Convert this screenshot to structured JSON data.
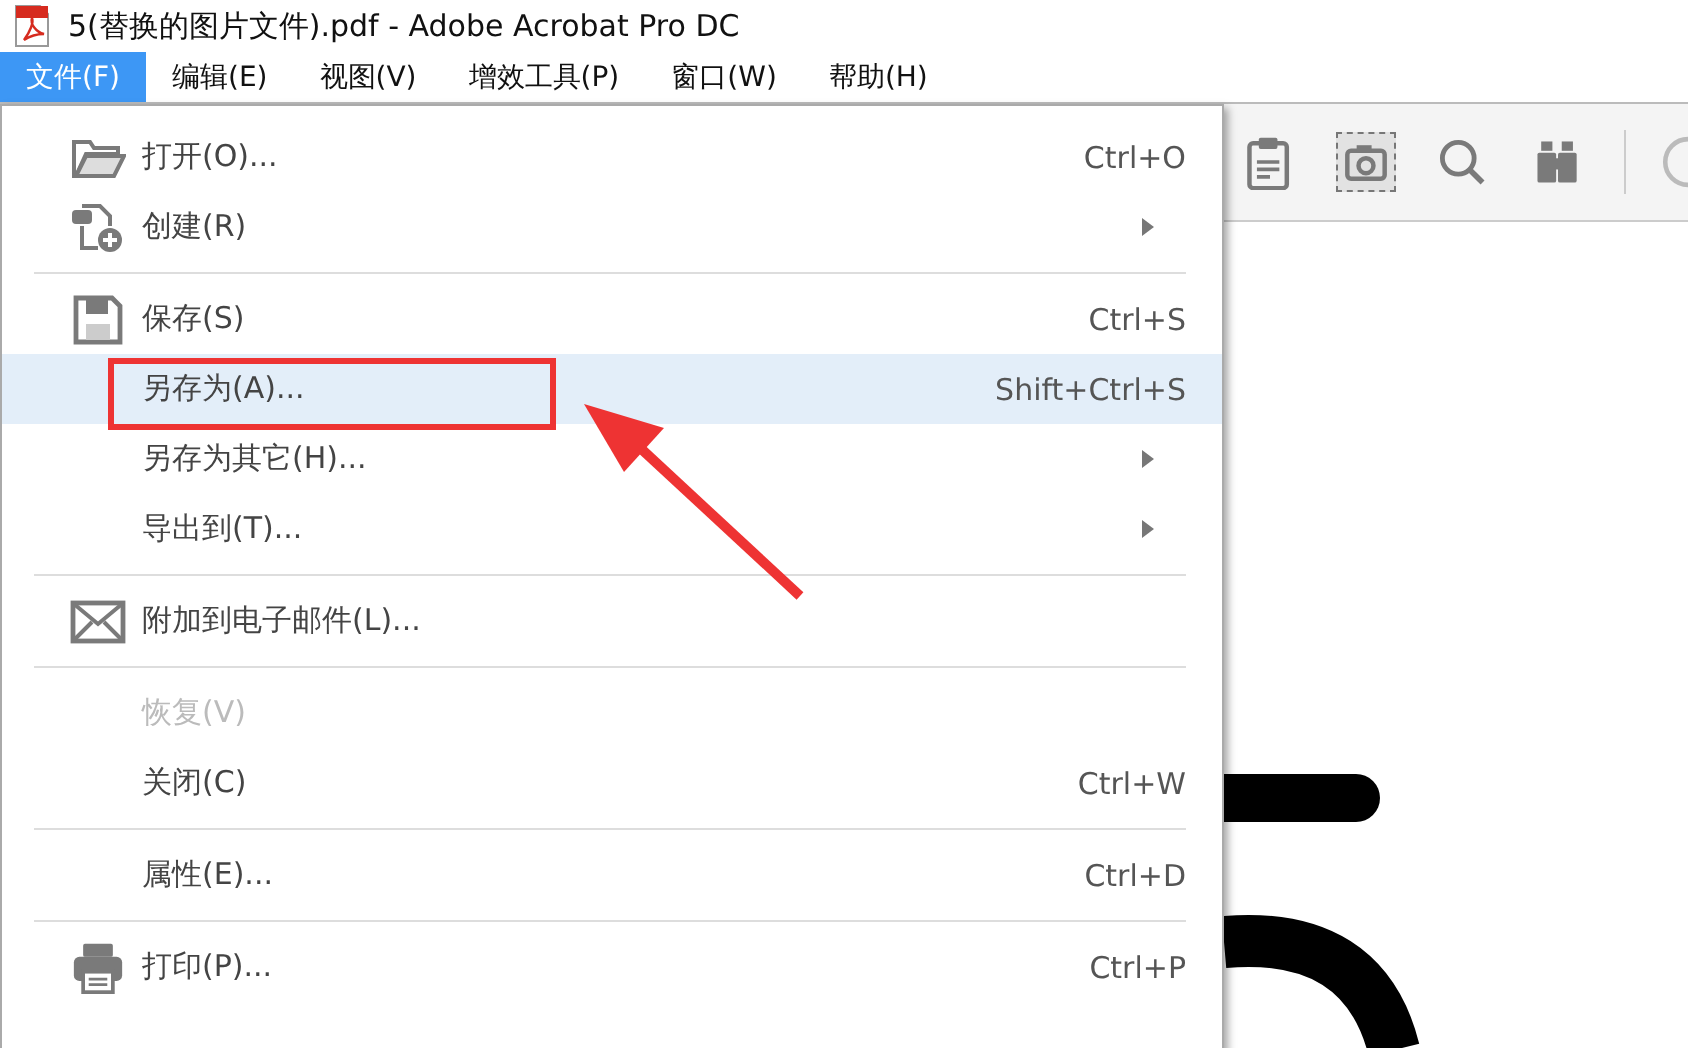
{
  "window": {
    "title": "5(替换的图片文件).pdf - Adobe Acrobat Pro DC"
  },
  "menubar": [
    {
      "label": "文件(F)",
      "selected": true
    },
    {
      "label": "编辑(E)",
      "selected": false
    },
    {
      "label": "视图(V)",
      "selected": false
    },
    {
      "label": "增效工具(P)",
      "selected": false
    },
    {
      "label": "窗口(W)",
      "selected": false
    },
    {
      "label": "帮助(H)",
      "selected": false
    }
  ],
  "toolbar": [
    {
      "kind": "clipboard",
      "selected": false
    },
    {
      "kind": "camera",
      "selected": true
    },
    {
      "kind": "search",
      "selected": false
    },
    {
      "kind": "binoculars",
      "selected": false
    }
  ],
  "file_menu": [
    [
      {
        "kind": "open",
        "label": "打开(O)...",
        "shortcut": "Ctrl+O",
        "submenu": false,
        "disabled": false,
        "selected": false
      },
      {
        "kind": "create",
        "label": "创建(R)",
        "submenu": true,
        "disabled": false,
        "selected": false
      }
    ],
    [
      {
        "kind": "save",
        "label": "保存(S)",
        "shortcut": "Ctrl+S",
        "submenu": false,
        "disabled": false,
        "selected": false
      },
      {
        "kind": "plain",
        "label": "另存为(A)...",
        "shortcut": "Shift+Ctrl+S",
        "submenu": false,
        "disabled": false,
        "selected": true
      },
      {
        "kind": "plain",
        "label": "另存为其它(H)...",
        "submenu": true,
        "disabled": false,
        "selected": false
      },
      {
        "kind": "plain",
        "label": "导出到(T)...",
        "submenu": true,
        "disabled": false,
        "selected": false
      }
    ],
    [
      {
        "kind": "email",
        "label": "附加到电子邮件(L)...",
        "submenu": false,
        "disabled": false,
        "selected": false
      }
    ],
    [
      {
        "kind": "plain",
        "label": "恢复(V)",
        "submenu": false,
        "disabled": true,
        "selected": false
      },
      {
        "kind": "plain",
        "label": "关闭(C)",
        "shortcut": "Ctrl+W",
        "submenu": false,
        "disabled": false,
        "selected": false
      }
    ],
    [
      {
        "kind": "plain",
        "label": "属性(E)...",
        "shortcut": "Ctrl+D",
        "submenu": false,
        "disabled": false,
        "selected": false
      }
    ],
    [
      {
        "kind": "print",
        "label": "打印(P)...",
        "shortcut": "Ctrl+P",
        "submenu": false,
        "disabled": false,
        "selected": false
      }
    ]
  ]
}
